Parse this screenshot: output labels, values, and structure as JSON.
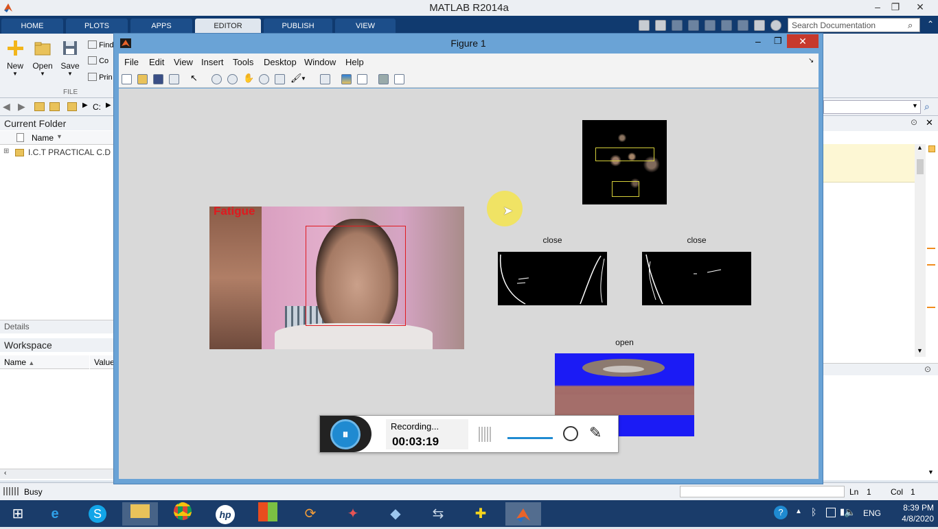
{
  "app": {
    "title": "MATLAB R2014a"
  },
  "ribbon": {
    "tabs": [
      "HOME",
      "PLOTS",
      "APPS",
      "EDITOR",
      "PUBLISH",
      "VIEW"
    ],
    "active_tab": "EDITOR",
    "search_placeholder": "Search Documentation",
    "file_buttons": {
      "new": "New",
      "open": "Open",
      "save": "Save"
    },
    "small_buttons": [
      "Find",
      "Co",
      "Prin"
    ],
    "section_label": "FILE"
  },
  "path": {
    "current": "C:"
  },
  "current_folder": {
    "title": "Current Folder",
    "column": "Name",
    "items": [
      {
        "name": "I.C.T PRACTICAL C.D"
      }
    ]
  },
  "details": {
    "title": "Details"
  },
  "workspace": {
    "title": "Workspace",
    "columns": [
      "Name",
      "Value"
    ]
  },
  "status": {
    "text": "Busy",
    "ln_label": "Ln",
    "ln": "1",
    "col_label": "Col",
    "col": "1"
  },
  "figure": {
    "title": "Figure 1",
    "menu": [
      "File",
      "Edit",
      "View",
      "Insert",
      "Tools",
      "Desktop",
      "Window",
      "Help"
    ],
    "main_label": "Fatigue",
    "subplots": {
      "close_left": "close",
      "close_right": "close",
      "open": "open"
    }
  },
  "recorder": {
    "status": "Recording...",
    "time": "00:03:19"
  },
  "taskbar": {
    "lang": "ENG",
    "time": "8:39 PM",
    "date": "4/8/2020"
  },
  "colors": {
    "ribbon": "#103a6f",
    "figure_frame": "#6aa3d6",
    "fatigue_label": "#e0191f",
    "recorder_accent": "#1f8ad1"
  }
}
